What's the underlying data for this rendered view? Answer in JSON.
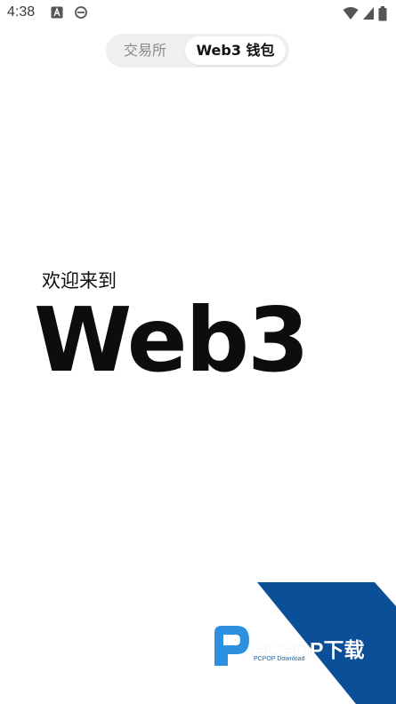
{
  "status_bar": {
    "time": "4:38",
    "left_icons": [
      "a-notification-icon",
      "browser-notification-icon"
    ],
    "right_icons": [
      "wifi-icon",
      "cell-signal-icon",
      "battery-icon"
    ]
  },
  "tabs": {
    "items": [
      {
        "label": "交易所"
      },
      {
        "label": "Web3 钱包"
      }
    ],
    "selected": "Web3 钱包"
  },
  "hero": {
    "welcome": "欢迎来到",
    "title": "Web3"
  },
  "watermark": {
    "brand": "PCPOP下载",
    "sub": "PCPOP Download",
    "colors": {
      "blue": "#0a4f97",
      "light_blue": "#2d8fe0"
    }
  }
}
